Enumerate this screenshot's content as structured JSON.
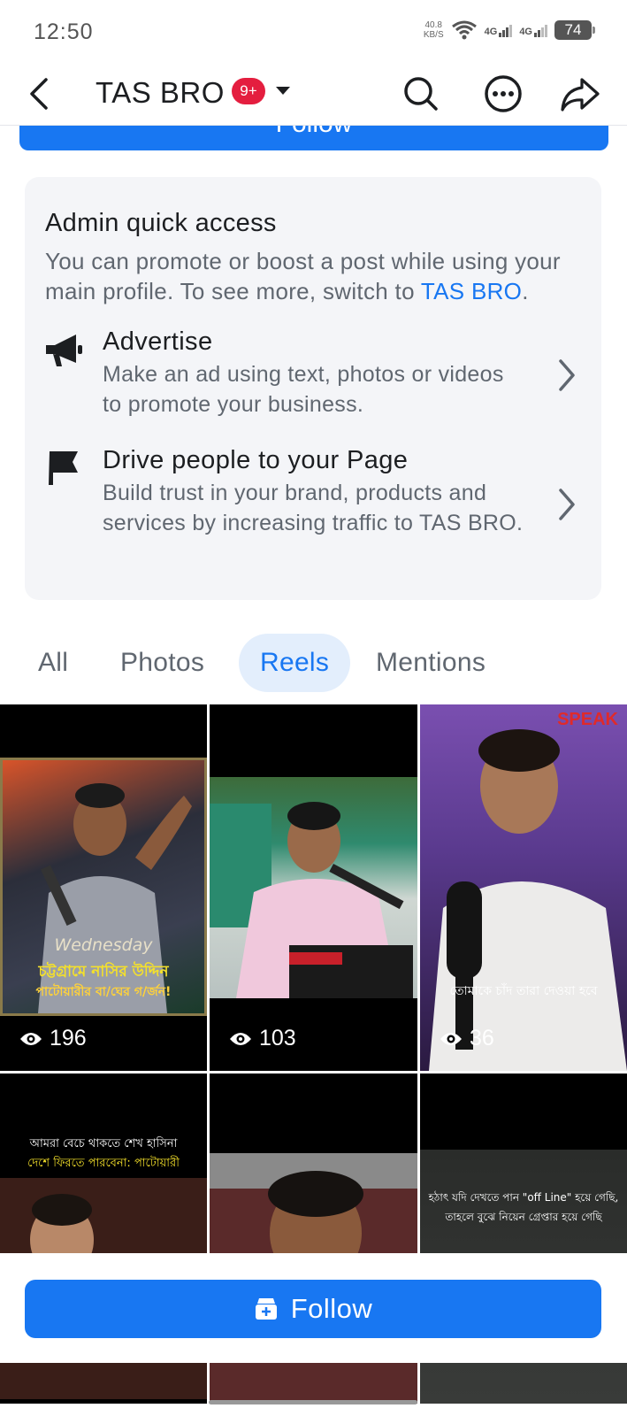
{
  "status_bar": {
    "time": "12:50",
    "speed_value": "40.8",
    "speed_unit": "KB/S",
    "net1": "4G",
    "net2": "4G",
    "battery": "74"
  },
  "header": {
    "page_name": "TAS BRO",
    "notification_badge": "9+"
  },
  "follow_top_label": "Follow",
  "admin_card": {
    "title": "Admin quick access",
    "desc_prefix": "You can promote or boost a post while using your main profile. To see more, switch to ",
    "desc_link": "TAS BRO",
    "desc_suffix": ".",
    "items": [
      {
        "title": "Advertise",
        "desc": "Make an ad using text, photos or videos to promote your business.",
        "icon": "megaphone-icon"
      },
      {
        "title": "Drive people to your Page",
        "desc": "Build trust in your brand, products and services by increasing traffic to TAS BRO.",
        "icon": "flag-icon"
      }
    ]
  },
  "tabs": [
    {
      "label": "All",
      "active": false
    },
    {
      "label": "Photos",
      "active": false
    },
    {
      "label": "Reels",
      "active": true
    },
    {
      "label": "Mentions",
      "active": false
    }
  ],
  "reels": [
    {
      "views": "196",
      "caption_line1": "Wednesday",
      "caption_line2": "চট্টগ্রামে নাসির উদ্দিন",
      "caption_line3": "পাটোয়ারীর বা/ঘের গ/র্জন!"
    },
    {
      "views": "103"
    },
    {
      "views": "36",
      "caption": "তোমাকে চাঁদ তারা দেওয়া হবে",
      "brand": "SPEAK"
    },
    {
      "caption_line1": "আমরা বেচে থাকতে শেখ হাসিনা",
      "caption_line2": "দেশে ফিরতে পারবেনা: পাটোয়ারী"
    },
    {},
    {
      "caption_line1": "হঠাৎ যদি দেখতে পান \"off Line\" হয়ে গেছি,",
      "caption_line2": "তাহলে বুঝে নিয়েন গ্রেপ্তার হয়ে গেছি"
    }
  ],
  "follow_bottom_label": "Follow",
  "colors": {
    "accent": "#1877f2",
    "badge": "#e41e3f",
    "card_bg": "#f4f5f8"
  }
}
